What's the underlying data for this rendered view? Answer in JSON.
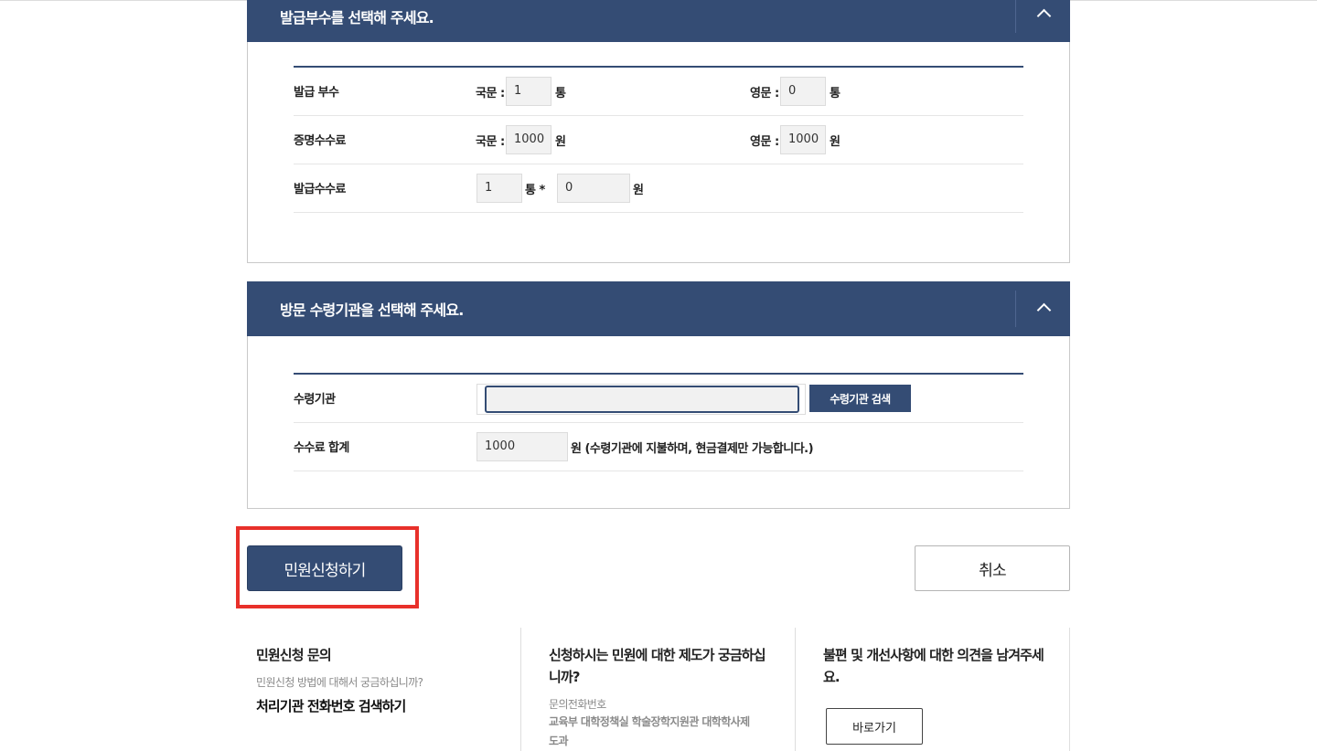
{
  "issue_section": {
    "title": "발급부수를 선택해 주세요.",
    "rows": {
      "copies": {
        "label": "발급 부수",
        "ko_label": "국문 :",
        "ko_value": "1",
        "ko_unit": "통",
        "en_label": "영문 :",
        "en_value": "0",
        "en_unit": "통"
      },
      "cert_fee": {
        "label": "증명수수료",
        "ko_label": "국문 :",
        "ko_value": "1000",
        "ko_unit": "원",
        "en_label": "영문 :",
        "en_value": "1000",
        "en_unit": "원"
      },
      "issue_fee": {
        "label": "발급수수료",
        "count_value": "1",
        "count_unit": "통 *",
        "amount_value": "0",
        "amount_unit": "원"
      }
    }
  },
  "visit_section": {
    "title": "방문 수령기관을 선택해 주세요.",
    "agency": {
      "label": "수령기관",
      "value": "",
      "search_button": "수령기관 검색"
    },
    "total": {
      "label": "수수료 합계",
      "value": "1000",
      "note": "원 (수령기관에 지불하며, 현금결제만 가능합니다.)"
    }
  },
  "actions": {
    "submit": "민원신청하기",
    "cancel": "취소"
  },
  "info": {
    "inquiry": {
      "title": "민원신청 문의",
      "subtitle": "민원신청 방법에 대해서 궁금하십니까?",
      "link": "처리기관 전화번호 검색하기"
    },
    "system": {
      "title_line1": "신청하시는 민원에 대한 제도가 궁금하십",
      "title_line2": "니까?",
      "phone_label": "문의전화번호",
      "org_line1": "교육부 대학정책실 학술장학지원관 대학학사제",
      "org_line2": "도과"
    },
    "feedback": {
      "title_line1": "불편 및 개선사항에 대한 의견을 남겨주세",
      "title_line2": "요.",
      "button": "바로가기"
    }
  },
  "colors": {
    "primary": "#344c74",
    "highlight": "#e8302a"
  }
}
